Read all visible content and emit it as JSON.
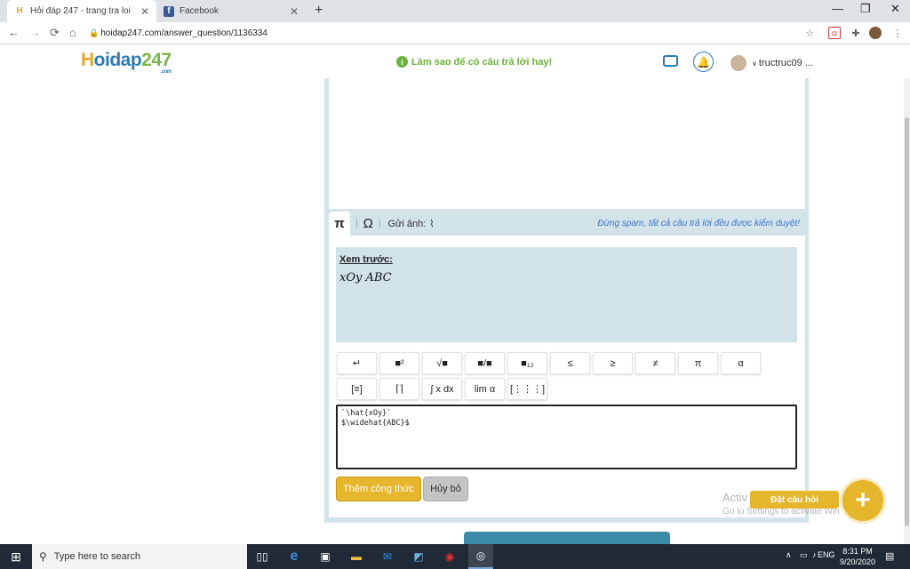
{
  "browser": {
    "tabs": [
      {
        "title": "Hỏi đáp 247 - trang tra loi",
        "active": true
      },
      {
        "title": "Facebook",
        "active": false
      }
    ],
    "tab_close": "✕",
    "new_tab": "+",
    "window_controls": {
      "minimize": "—",
      "restore": "❐",
      "close": "✕"
    },
    "url": "hoidap247.com/answer_question/1136334",
    "nav": {
      "back": "←",
      "forward": "→",
      "reload": "⟳",
      "home": "⌂"
    }
  },
  "header": {
    "logo_h": "H",
    "logo_text": "oidap",
    "logo_num": "247",
    "logo_com": ".com",
    "tip": "Làm sao để có câu trả lời hay!",
    "username": "tructruc09 ..."
  },
  "editor": {
    "tabs": {
      "pi": "π",
      "omega": "Ω",
      "send_image": "Gửi ảnh:"
    },
    "spam_notice": "Đừng spam, tất cả câu trả lời đều được kiểm duyệt!",
    "preview_label": "Xem trước:",
    "preview_math": "xOy ABC",
    "row1": [
      "↵",
      "■²",
      "√■",
      "■/■",
      "■₁₂",
      "≤",
      "≥",
      "≠",
      "π",
      "α"
    ],
    "row2": [
      "[≡]",
      "⌈⌉",
      "∫ x dx",
      "lim α",
      "[⋮⋮⋮]"
    ],
    "formula_text": "`\\hat{xOy}`\n$\\widehat{ABC}$",
    "add_formula": "Thêm công thức",
    "cancel": "Hủy bỏ"
  },
  "floating": {
    "ask_label": "Đặt câu hỏi",
    "ask_plus": "+",
    "watermark_line1": "Activ",
    "watermark_line2": "Go to Settings to activate Win"
  },
  "taskbar": {
    "search_placeholder": "Type here to search",
    "lang": "ENG",
    "time": "8:31 PM",
    "date": "9/20/2020"
  },
  "colors": {
    "brand_blue": "#2d7bb6",
    "accent_yellow": "#e5b52b",
    "tip_green": "#6bb23c",
    "panel_bg": "#d3e3ea"
  }
}
